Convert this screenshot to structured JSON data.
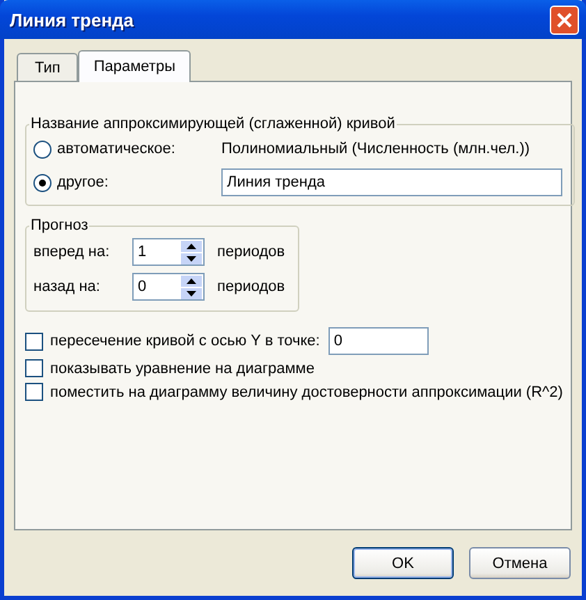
{
  "window": {
    "title": "Линия тренда"
  },
  "tabs": [
    {
      "label": "Тип",
      "selected": false
    },
    {
      "label": "Параметры",
      "selected": true
    }
  ],
  "name_group": {
    "legend": "Название аппроксимирующей (сглаженной) кривой",
    "options": [
      {
        "kind": "text",
        "label": "автоматическое:",
        "selected": false,
        "text": "Полиномиальный (Численность (млн.чел.))"
      },
      {
        "kind": "input",
        "label": "другое:",
        "selected": true,
        "value": "Линия тренда"
      }
    ]
  },
  "forecast": {
    "legend": "Прогноз",
    "rows": [
      {
        "label": "вперед на:",
        "value": "1",
        "unit": "периодов"
      },
      {
        "label": "назад на:",
        "value": "0",
        "unit": "периодов"
      }
    ]
  },
  "options": [
    {
      "kind": "input",
      "label": "пересечение кривой с осью Y в точке:",
      "checked": false,
      "value": "0"
    },
    {
      "kind": "plain",
      "label": "показывать уравнение на диаграмме",
      "checked": false
    },
    {
      "kind": "plain",
      "label": "поместить на диаграмму величину достоверности аппроксимации (R^2)",
      "checked": false
    }
  ],
  "buttons": [
    {
      "label": "OK",
      "default": true
    },
    {
      "label": "Отмена",
      "default": false
    }
  ]
}
